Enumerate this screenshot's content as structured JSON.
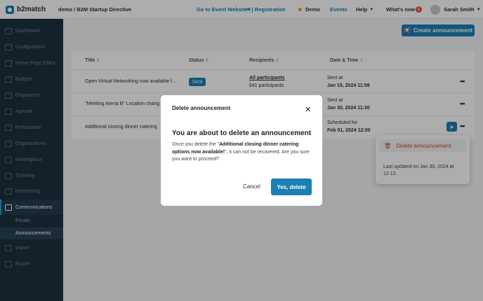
{
  "topbar": {
    "brand": "b2match",
    "breadcrumb": "demo / B2M Startup Directive",
    "go_to_event": "Go to Event Website",
    "registration": "| Registration",
    "demo": "Demo",
    "events": "Events",
    "help": "Help",
    "whats_new": "What's new",
    "whats_new_count": "1",
    "user": "Sarah Smith",
    "accent_color": "#1b7fb5",
    "demo_dot_color": "#e89a3c"
  },
  "sidebar": {
    "items": [
      {
        "label": "Dashboard",
        "icon": "dashboard-icon"
      },
      {
        "label": "Configuration",
        "icon": "gear-icon"
      },
      {
        "label": "Home Page Editor",
        "icon": "page-icon"
      },
      {
        "label": "Badges",
        "icon": "badge-icon"
      },
      {
        "label": "Organizers",
        "icon": "users-icon"
      },
      {
        "label": "Agenda",
        "icon": "calendar-icon"
      },
      {
        "label": "Participants",
        "icon": "people-icon"
      },
      {
        "label": "Organizations",
        "icon": "building-icon"
      },
      {
        "label": "Marketplace",
        "icon": "list-icon"
      },
      {
        "label": "Ticketing",
        "icon": "ticket-icon"
      },
      {
        "label": "Networking",
        "icon": "handshake-icon"
      },
      {
        "label": "Communications",
        "icon": "chat-icon"
      }
    ],
    "sub_items": [
      {
        "label": "Emails"
      },
      {
        "label": "Announcements"
      }
    ],
    "bottom_items": [
      {
        "label": "Import",
        "icon": "import-icon"
      },
      {
        "label": "Export",
        "icon": "export-icon"
      }
    ]
  },
  "main": {
    "create_button": "Create announcement",
    "columns": [
      "Title",
      "Status",
      "Recipients",
      "Date & Time"
    ],
    "rows": [
      {
        "title": "Open Virtual Networking now available f...",
        "status": "Sent",
        "recipients": "All participants",
        "recipients_count": "641 participants",
        "date_label": "Sent at",
        "date": "Jan 15, 2024 11:58"
      },
      {
        "title": "\"Meeting Arena B\" Location chang",
        "date_label": "Sent at",
        "date": "Jan 30, 2024 11:30"
      },
      {
        "title": "Additional closing dinner catering",
        "date_label": "Scheduled for",
        "date": "Feb 01, 2024 12:00"
      }
    ],
    "more": "•••",
    "dropdown": {
      "delete": "Delete announcement",
      "updated": "Last updated on Jan 30, 2024 at 12:12."
    }
  },
  "modal": {
    "title": "Delete announcement",
    "heading": "You are about to delete an announcement",
    "body_prefix": "Once you delete the \"",
    "body_bold": "Additional closing dinner catering options now available!",
    "body_suffix": "\", it can not be recovered. Are you sure you want to proceed?",
    "cancel": "Cancel",
    "confirm": "Yes, delete"
  }
}
